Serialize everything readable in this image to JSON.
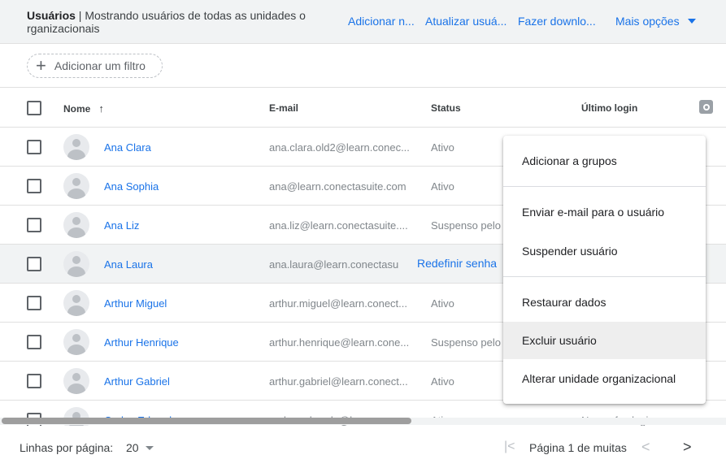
{
  "header": {
    "title_bold": "Usuários",
    "title_rest": " | Mostrando usuários de todas as unidades o rganizacionais",
    "actions": {
      "add": "Adicionar n...",
      "update": "Atualizar usuá...",
      "download": "Fazer downlo...",
      "more": "Mais opções"
    }
  },
  "filter": {
    "label": "Adicionar um filtro"
  },
  "columns": {
    "name": "Nome",
    "email": "E-mail",
    "status": "Status",
    "last_login": "Último login"
  },
  "rows": [
    {
      "name": "Ana Clara",
      "email": "ana.clara.old2@learn.conec...",
      "status": "Ativo"
    },
    {
      "name": "Ana Sophia",
      "email": "ana@learn.conectasuite.com",
      "status": "Ativo"
    },
    {
      "name": "Ana Liz",
      "email": "ana.liz@learn.conectasuite....",
      "status": "Suspenso pelo a"
    },
    {
      "name": "Ana Laura",
      "email": "ana.laura@learn.conectasu",
      "status": "",
      "hover_action": "Redefinir senha"
    },
    {
      "name": "Arthur Miguel",
      "email": "arthur.miguel@learn.conect...",
      "status": "Ativo"
    },
    {
      "name": "Arthur Henrique",
      "email": "arthur.henrique@learn.cone...",
      "status": "Suspenso pelo a"
    },
    {
      "name": "Arthur Gabriel",
      "email": "arthur.gabriel@learn.conect...",
      "status": "Ativo"
    },
    {
      "name": "Carlos Eduardo",
      "email": "carlos.eduardo@learn.cone...",
      "status": "Ativo",
      "last_login": "Nunca fez login"
    }
  ],
  "menu": {
    "items": [
      "Adicionar a grupos",
      "Enviar e-mail para o usuário",
      "Suspender usuário",
      "Restaurar dados",
      "Excluir usuário",
      "Alterar unidade organizacional"
    ]
  },
  "footer": {
    "rows_label": "Linhas por página:",
    "rows_value": "20",
    "page_label": "Página 1 de muitas",
    "first_icon": "|<",
    "prev_icon": "<",
    "next_icon": ">"
  }
}
